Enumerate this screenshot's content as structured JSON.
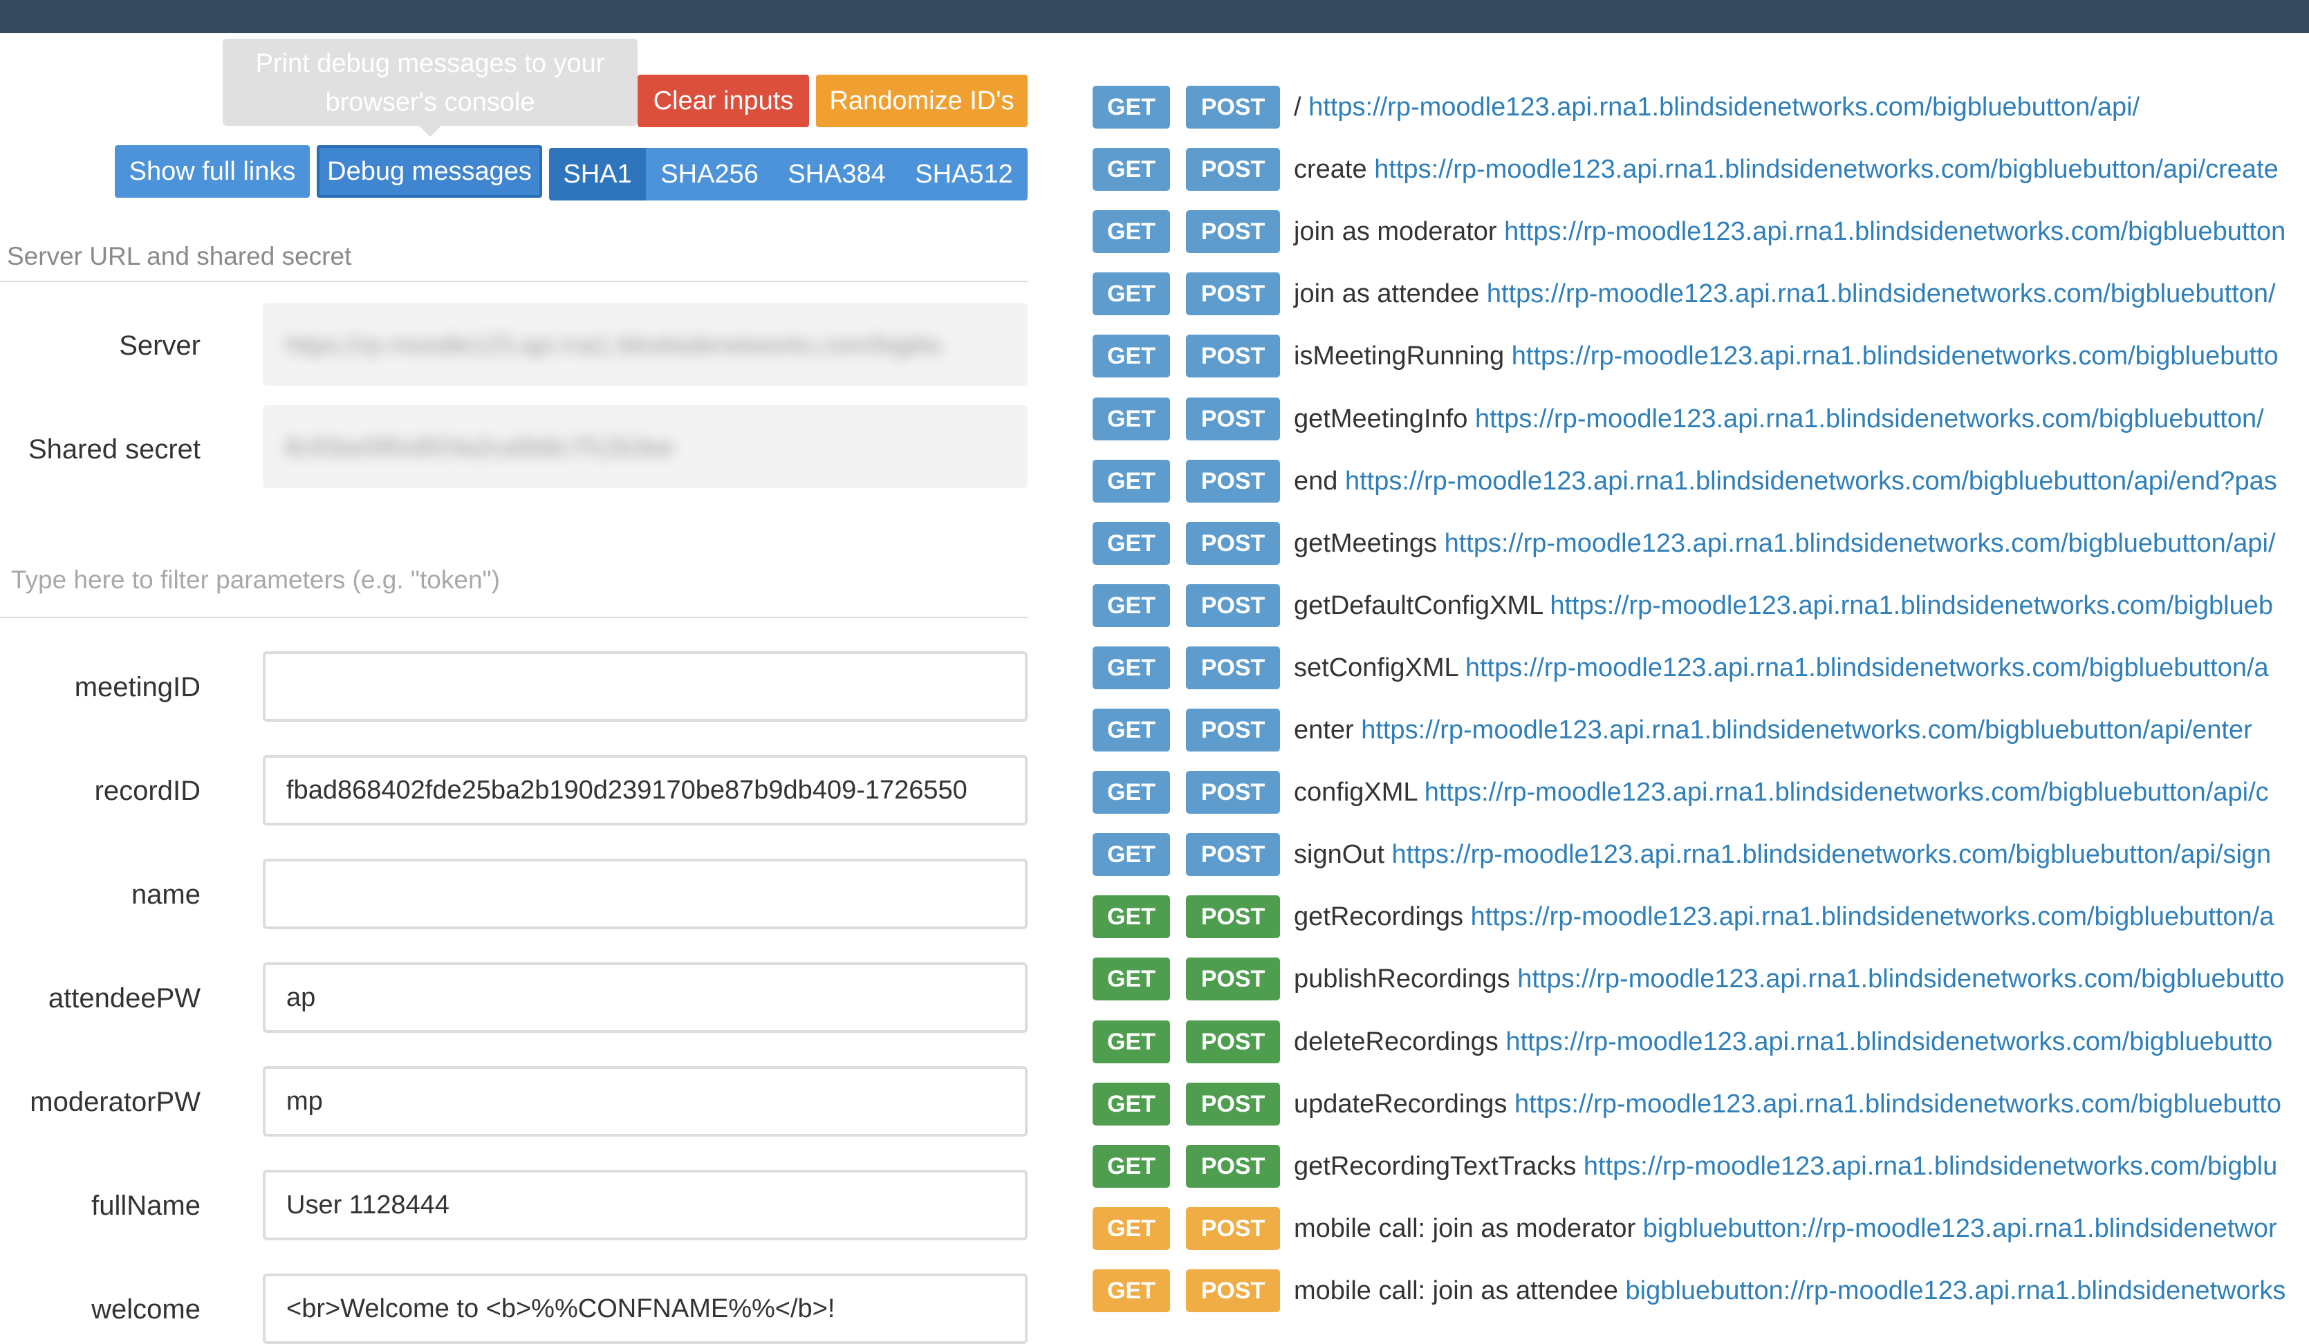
{
  "toolbar": {
    "tooltip": "Print debug messages to your browser's console",
    "clear_inputs": "Clear inputs",
    "randomize_ids": "Randomize ID's",
    "show_full_links": "Show full links",
    "debug_messages": "Debug messages",
    "hash_options": [
      "SHA1",
      "SHA256",
      "SHA384",
      "SHA512"
    ],
    "hash_selected": "SHA1"
  },
  "server_section": {
    "label": "Server URL and shared secret",
    "server_label": "Server",
    "server_value": "https://rp-moodle123.api.rna1.blindsidenetworks.com/bigblu",
    "secret_label": "Shared secret",
    "secret_value": "8c93ee5f0c6f24a2ca5b8c7f12b3ee"
  },
  "filter": {
    "placeholder": "Type here to filter parameters (e.g. \"token\")"
  },
  "params": [
    {
      "label": "meetingID",
      "value": ""
    },
    {
      "label": "recordID",
      "value": "fbad868402fde25ba2b190d239170be87b9db409-1726550"
    },
    {
      "label": "name",
      "value": ""
    },
    {
      "label": "attendeePW",
      "value": "ap"
    },
    {
      "label": "moderatorPW",
      "value": "mp"
    },
    {
      "label": "fullName",
      "value": "User 1128444"
    },
    {
      "label": "welcome",
      "value": "<br>Welcome to <b>%%CONFNAME%%</b>!"
    }
  ],
  "api_calls": {
    "get_label": "GET",
    "post_label": "POST",
    "colors": {
      "blue": "#5d9ccd",
      "green": "#4f9d4f",
      "orange": "#f0ac45"
    },
    "items": [
      {
        "name": "/",
        "link": "https://rp-moodle123.api.rna1.blindsidenetworks.com/bigbluebutton/api/",
        "color": "blue"
      },
      {
        "name": "create",
        "link": "https://rp-moodle123.api.rna1.blindsidenetworks.com/bigbluebutton/api/create",
        "color": "blue"
      },
      {
        "name": "join as moderator",
        "link": "https://rp-moodle123.api.rna1.blindsidenetworks.com/bigbluebutton",
        "color": "blue"
      },
      {
        "name": "join as attendee",
        "link": "https://rp-moodle123.api.rna1.blindsidenetworks.com/bigbluebutton/",
        "color": "blue"
      },
      {
        "name": "isMeetingRunning",
        "link": "https://rp-moodle123.api.rna1.blindsidenetworks.com/bigbluebutto",
        "color": "blue"
      },
      {
        "name": "getMeetingInfo",
        "link": "https://rp-moodle123.api.rna1.blindsidenetworks.com/bigbluebutton/",
        "color": "blue"
      },
      {
        "name": "end",
        "link": "https://rp-moodle123.api.rna1.blindsidenetworks.com/bigbluebutton/api/end?pas",
        "color": "blue"
      },
      {
        "name": "getMeetings",
        "link": "https://rp-moodle123.api.rna1.blindsidenetworks.com/bigbluebutton/api/",
        "color": "blue"
      },
      {
        "name": "getDefaultConfigXML",
        "link": "https://rp-moodle123.api.rna1.blindsidenetworks.com/bigblueb",
        "color": "blue"
      },
      {
        "name": "setConfigXML",
        "link": "https://rp-moodle123.api.rna1.blindsidenetworks.com/bigbluebutton/a",
        "color": "blue"
      },
      {
        "name": "enter",
        "link": "https://rp-moodle123.api.rna1.blindsidenetworks.com/bigbluebutton/api/enter",
        "color": "blue"
      },
      {
        "name": "configXML",
        "link": "https://rp-moodle123.api.rna1.blindsidenetworks.com/bigbluebutton/api/c",
        "color": "blue"
      },
      {
        "name": "signOut",
        "link": "https://rp-moodle123.api.rna1.blindsidenetworks.com/bigbluebutton/api/sign",
        "color": "blue"
      },
      {
        "name": "getRecordings",
        "link": "https://rp-moodle123.api.rna1.blindsidenetworks.com/bigbluebutton/a",
        "color": "green"
      },
      {
        "name": "publishRecordings",
        "link": "https://rp-moodle123.api.rna1.blindsidenetworks.com/bigbluebutto",
        "color": "green"
      },
      {
        "name": "deleteRecordings",
        "link": "https://rp-moodle123.api.rna1.blindsidenetworks.com/bigbluebutto",
        "color": "green"
      },
      {
        "name": "updateRecordings",
        "link": "https://rp-moodle123.api.rna1.blindsidenetworks.com/bigbluebutto",
        "color": "green"
      },
      {
        "name": "getRecordingTextTracks",
        "link": "https://rp-moodle123.api.rna1.blindsidenetworks.com/bigblu",
        "color": "green"
      },
      {
        "name": "mobile call: join as moderator",
        "link": "bigbluebutton://rp-moodle123.api.rna1.blindsidenetwor",
        "color": "orange"
      },
      {
        "name": "mobile call: join as attendee",
        "link": "bigbluebutton://rp-moodle123.api.rna1.blindsidenetworks",
        "color": "orange"
      }
    ]
  }
}
